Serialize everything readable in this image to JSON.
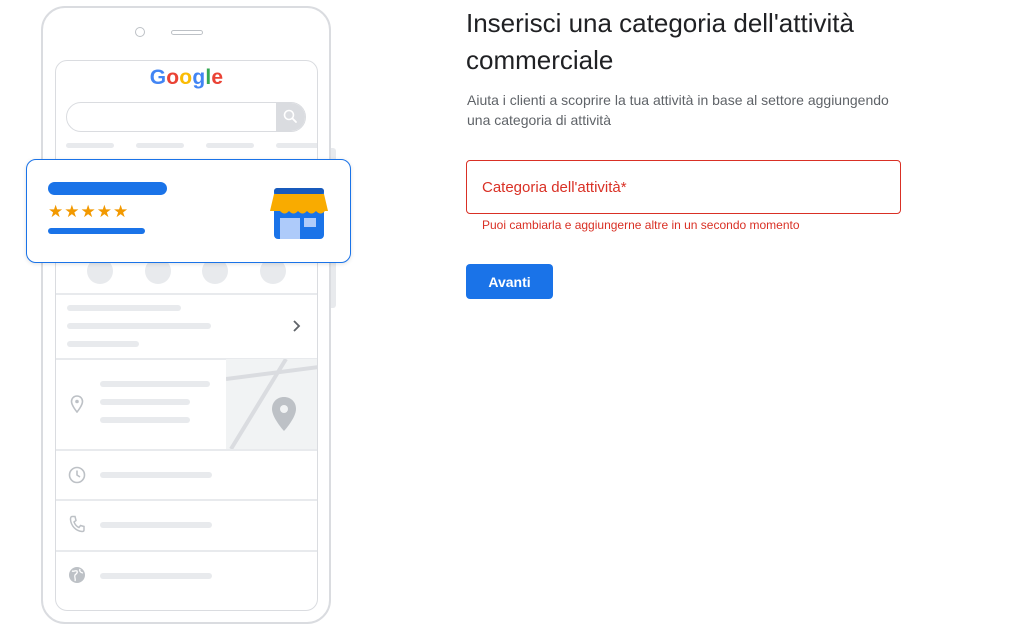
{
  "illustration": {
    "logo_letters": [
      {
        "char": "G",
        "color": "#4285f4"
      },
      {
        "char": "o",
        "color": "#ea4335"
      },
      {
        "char": "o",
        "color": "#fbbc05"
      },
      {
        "char": "g",
        "color": "#4285f4"
      },
      {
        "char": "l",
        "color": "#34a853"
      },
      {
        "char": "e",
        "color": "#ea4335"
      }
    ],
    "rating_stars": "★★★★★",
    "star_color": "#f29900",
    "accent_color": "#1a73e8",
    "icons": [
      "search-icon",
      "phone-icon",
      "directions-icon",
      "bookmark-icon",
      "globe-icon",
      "chevron-right-icon",
      "location-pin-icon",
      "clock-icon",
      "store-icon"
    ]
  },
  "form": {
    "title": "Inserisci una categoria dell'attività commerciale",
    "description": "Aiuta i clienti a scoprire la tua attività in base al settore aggiungendo una categoria di attività",
    "field_label": "Categoria dell'attività*",
    "field_value": "",
    "helper_text": "Puoi cambiarla e aggiungerne altre in un secondo momento",
    "error_color": "#d93025",
    "next_button": "Avanti"
  }
}
